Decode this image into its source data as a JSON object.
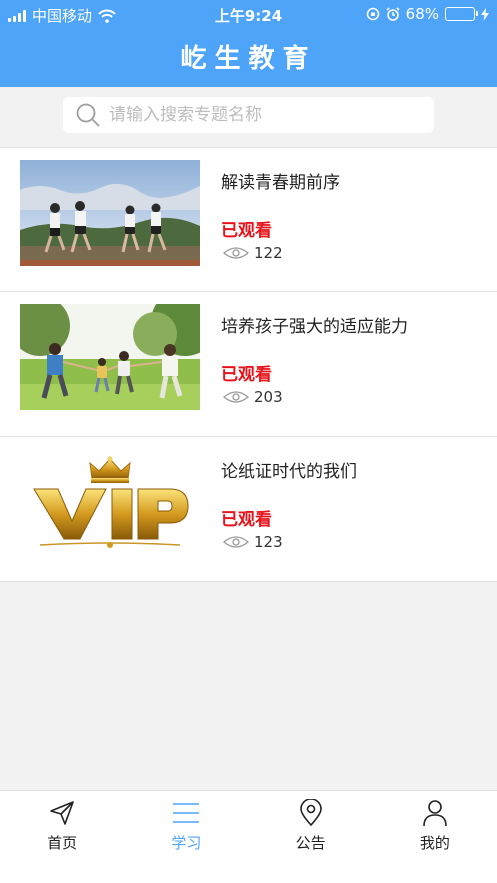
{
  "status_bar": {
    "carrier": "中国移动",
    "time": "上午9:24",
    "battery": "68%",
    "battery_level": 0.68
  },
  "header": {
    "title": "屹生教育"
  },
  "search": {
    "placeholder": "请输入搜索专题名称"
  },
  "topics": [
    {
      "title": "解读青春期前序",
      "status": "已观看",
      "views": "122",
      "image": "kids-running-photo"
    },
    {
      "title": "培养孩子强大的适应能力",
      "status": "已观看",
      "views": "203",
      "image": "family-park-photo"
    },
    {
      "title": "论纸证时代的我们",
      "status": "已观看",
      "views": "123",
      "image": "vip-crown-logo"
    }
  ],
  "tabbar": {
    "tabs": [
      {
        "label": "首页",
        "icon": "send-icon",
        "active": false
      },
      {
        "label": "学习",
        "icon": "menu-icon",
        "active": true
      },
      {
        "label": "公告",
        "icon": "location-pin-icon",
        "active": false
      },
      {
        "label": "我的",
        "icon": "user-icon",
        "active": false
      }
    ]
  },
  "colors": {
    "accent": "#4da4f8",
    "watched": "#e8141b",
    "battery": "#4cd964"
  }
}
